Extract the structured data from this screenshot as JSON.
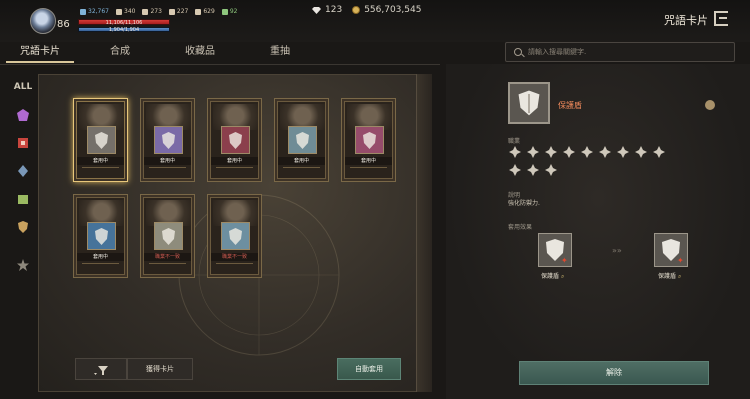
{
  "header": {
    "level": "86",
    "stats": [
      {
        "icon": "sword-icon",
        "value": "32,767",
        "color": "#7fb3d8"
      },
      {
        "icon": "fist-icon",
        "value": "340",
        "color": "#d7c9b1"
      },
      {
        "icon": "shield-icon",
        "value": "273",
        "color": "#d7c9b1"
      },
      {
        "icon": "wing-icon",
        "value": "227",
        "color": "#d7c9b1"
      },
      {
        "icon": "hand-icon",
        "value": "629",
        "color": "#d7c9b1"
      },
      {
        "icon": "leaf-icon",
        "value": "92",
        "color": "#8ec77d"
      }
    ],
    "hp_text": "11,106/11,106",
    "hp_fraction": 1.0,
    "mp_text": "1,904/1,904",
    "mp_fraction": 1.0,
    "currency": [
      {
        "icon": "diamond-icon",
        "value": "123"
      },
      {
        "icon": "gold-coin-icon",
        "value": "556,703,545"
      }
    ],
    "title": "咒語卡片"
  },
  "tabs": [
    "咒語卡片",
    "合成",
    "收藏品",
    "重抽"
  ],
  "active_tab": 0,
  "sidebar": [
    {
      "name": "sidebar-all",
      "label": "ALL",
      "color": "#d8cfc0"
    },
    {
      "name": "sidebar-gem-purple",
      "icon": "gem-icon",
      "color": "#b06ad1"
    },
    {
      "name": "sidebar-emblem-red",
      "icon": "emblem-icon",
      "color": "#c9463e"
    },
    {
      "name": "sidebar-rune-blue",
      "icon": "rune-icon",
      "color": "#7a98b8"
    },
    {
      "name": "sidebar-crest-green",
      "icon": "crest-icon",
      "color": "#9bba62"
    },
    {
      "name": "sidebar-shield-gold",
      "icon": "shield-icon",
      "color": "#c9a25f"
    },
    {
      "name": "sidebar-star-gray",
      "icon": "star-icon",
      "color": "#8e887c"
    }
  ],
  "cards": [
    {
      "status": "套用中",
      "state": "on",
      "art_color": "#75706a",
      "symbol": "shield-icon",
      "selected": true
    },
    {
      "status": "套用中",
      "state": "on",
      "art_color": "#7a6aa7",
      "symbol": "wind-icon"
    },
    {
      "status": "套用中",
      "state": "on",
      "art_color": "#8b3f4c",
      "symbol": "claw-icon"
    },
    {
      "status": "套用中",
      "state": "on",
      "art_color": "#6f8c96",
      "symbol": "burst-icon"
    },
    {
      "status": "套用中",
      "state": "on",
      "art_color": "#964c6a",
      "symbol": "crescent-icon"
    },
    {
      "status": "套用中",
      "state": "on",
      "art_color": "#46739a",
      "symbol": "slash-icon"
    },
    {
      "status": "職業不一致",
      "state": "off",
      "art_color": "#8e8c7c",
      "symbol": "wings-icon"
    },
    {
      "status": "職業不一致",
      "state": "off",
      "art_color": "#6d8fa0",
      "symbol": "blades-icon"
    }
  ],
  "buttons": {
    "filter": "filter-icon",
    "get_cards": "獲得卡片",
    "auto_equip": "自動套用",
    "unequip": "解除"
  },
  "search": {
    "placeholder": "請輸入搜尋關鍵字."
  },
  "detail": {
    "name": "保護盾",
    "class_label": "職業",
    "class_icons": [
      "sword-icon",
      "cross-icon",
      "gear-icon",
      "bow-icon",
      "wing-icon",
      "spear-icon",
      "claw-icon",
      "star-icon",
      "orb-icon",
      "flower-icon",
      "dagger-icon",
      "scythe-icon"
    ],
    "desc_label": "說明",
    "desc": "強化防禦力.",
    "effect_label": "套用效果",
    "effect_from": "保護盾",
    "effect_to": "保護盾",
    "arrow": "»»"
  }
}
